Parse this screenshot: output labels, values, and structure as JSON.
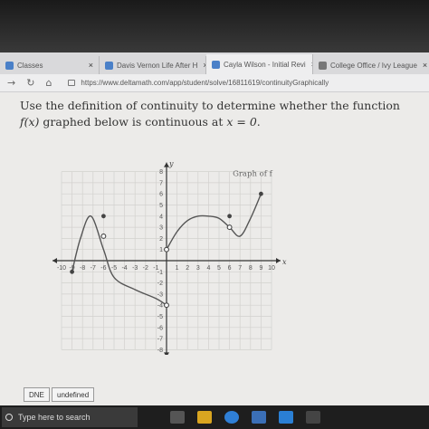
{
  "browser": {
    "tabs": [
      {
        "label": "Classes",
        "close": "×",
        "color": "#4a80c8"
      },
      {
        "label": "Davis Vernon Life After H",
        "close": "×",
        "color": "#4a80c8"
      },
      {
        "label": "Cayla Wilson - Initial Revi",
        "close": "×",
        "color": "#3b7fd1"
      },
      {
        "label": "College Office / Ivy League",
        "close": "×",
        "color": "#777777"
      }
    ],
    "url": "https://www.deltamath.com/app/student/solve/16811619/continuityGraphically"
  },
  "question": {
    "text_before": "Use the definition of continuity to determine whether the function ",
    "fx": "f(x)",
    "text_middle": " graphed below is continuous at ",
    "x_eq": "x = 0",
    "text_after": "."
  },
  "chart_data": {
    "type": "line",
    "title": "Graph of f",
    "xlabel": "x",
    "ylabel": "y",
    "xlim": [
      -10,
      10
    ],
    "ylim": [
      -8,
      8
    ],
    "grid": true,
    "x_ticks": [
      -10,
      -9,
      -8,
      -7,
      -6,
      -5,
      -4,
      -3,
      -2,
      -1,
      1,
      2,
      3,
      4,
      5,
      6,
      7,
      8,
      9,
      10
    ],
    "y_ticks": [
      -8,
      -7,
      -6,
      -5,
      -4,
      -3,
      -2,
      -1,
      1,
      2,
      3,
      4,
      5,
      6,
      7,
      8
    ],
    "curve_left": [
      [
        -9,
        -1
      ],
      [
        -8.2,
        2
      ],
      [
        -7.2,
        4
      ],
      [
        -6,
        1
      ],
      [
        -5,
        -1.5
      ],
      [
        -3,
        -2.6
      ],
      [
        -1,
        -3.4
      ],
      [
        0,
        -4
      ]
    ],
    "curve_right": [
      [
        0,
        1
      ],
      [
        1,
        2.6
      ],
      [
        2,
        3.6
      ],
      [
        3,
        4
      ],
      [
        4,
        4
      ],
      [
        5,
        3.8
      ],
      [
        6,
        3
      ],
      [
        7,
        2.2
      ],
      [
        8,
        3.8
      ],
      [
        9,
        6
      ]
    ],
    "open_points": [
      [
        -6,
        2.2
      ],
      [
        0,
        1
      ],
      [
        0,
        -4
      ],
      [
        6,
        3
      ]
    ],
    "closed_points": [
      [
        -9,
        -1
      ],
      [
        -6,
        4
      ],
      [
        6,
        4
      ],
      [
        9,
        6
      ]
    ]
  },
  "answers": {
    "dne": "DNE",
    "undefined": "undefined"
  },
  "taskbar": {
    "search_placeholder": "Type here to search"
  }
}
